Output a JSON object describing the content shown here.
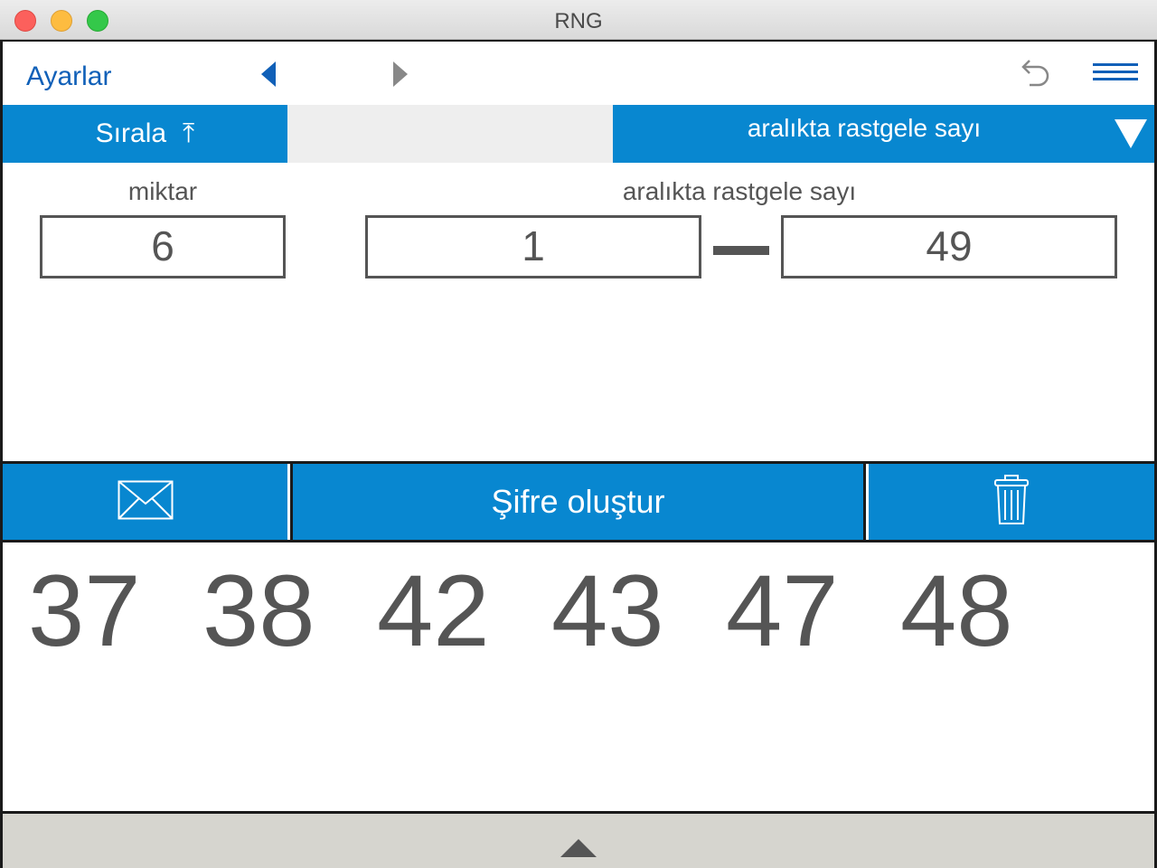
{
  "window": {
    "title": "RNG"
  },
  "toolbar": {
    "settings_label": "Ayarlar",
    "icons": [
      "nav-back-icon",
      "nav-forward-icon",
      "undo-icon",
      "menu-icon"
    ]
  },
  "options": {
    "sort_label": "Sırala",
    "sort_icon": "⤒",
    "mode_label": "aralıkta rastgele sayı"
  },
  "inputs": {
    "amount_label": "miktar",
    "amount_value": "6",
    "range_label": "aralıkta rastgele sayı",
    "range_min": "1",
    "range_max": "49"
  },
  "actions": {
    "generate_label": "Şifre oluştur"
  },
  "results": {
    "numbers": [
      "37",
      "38",
      "42",
      "43",
      "47",
      "48"
    ]
  },
  "colors": {
    "accent": "#0887d0",
    "link": "#1060b8",
    "text": "#555555",
    "bottom_bar": "#d6d5cf"
  }
}
